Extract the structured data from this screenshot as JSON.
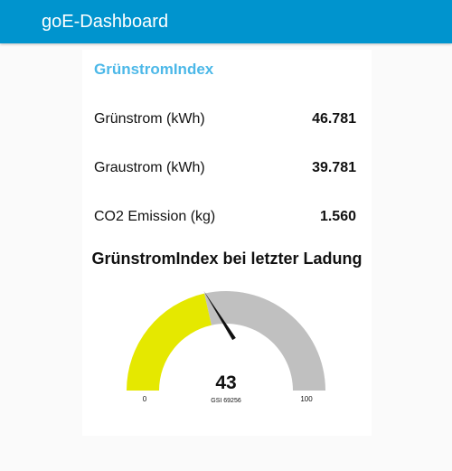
{
  "app": {
    "title": "goE-Dashboard"
  },
  "card": {
    "title": "GrünstromIndex",
    "rows": [
      {
        "label": "Grünstrom (kWh)",
        "value": "46.781"
      },
      {
        "label": "Graustrom (kWh)",
        "value": "39.781"
      },
      {
        "label": "CO2 Emission (kg)",
        "value": "1.560"
      }
    ]
  },
  "gauge": {
    "title": "GrünstromIndex bei letzter Ladung",
    "value": 43,
    "value_text": "43",
    "unit_text": "GSI 69256",
    "min": 0,
    "max": 100,
    "min_label": "0",
    "max_label": "100",
    "colors": {
      "fill": "#e5e800",
      "track": "#c0c0c0",
      "needle": "#111111"
    }
  }
}
